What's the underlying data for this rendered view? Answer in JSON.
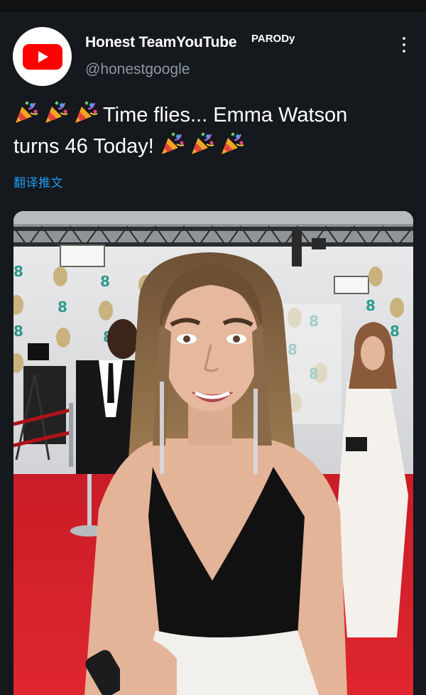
{
  "tweet": {
    "display_name": "Honest TeamYouTube",
    "parody_label": "PARODy",
    "handle": "@honestgoogle",
    "text_line1": "Time flies... Emma Watson",
    "text_line2": "turns 46 Today!",
    "translate_label": "翻译推文"
  },
  "media": {
    "backdrop_badge": "8"
  },
  "icons": {
    "avatar": "youtube-logo-icon",
    "more": "more-vertical-icon",
    "emoji": "party-popper-icon"
  },
  "colors": {
    "background": "#15181c",
    "link": "#1d9bf0",
    "youtube_red": "#ff0000",
    "handle_gray": "#8b98a5",
    "carpet_red": "#d5202b"
  }
}
